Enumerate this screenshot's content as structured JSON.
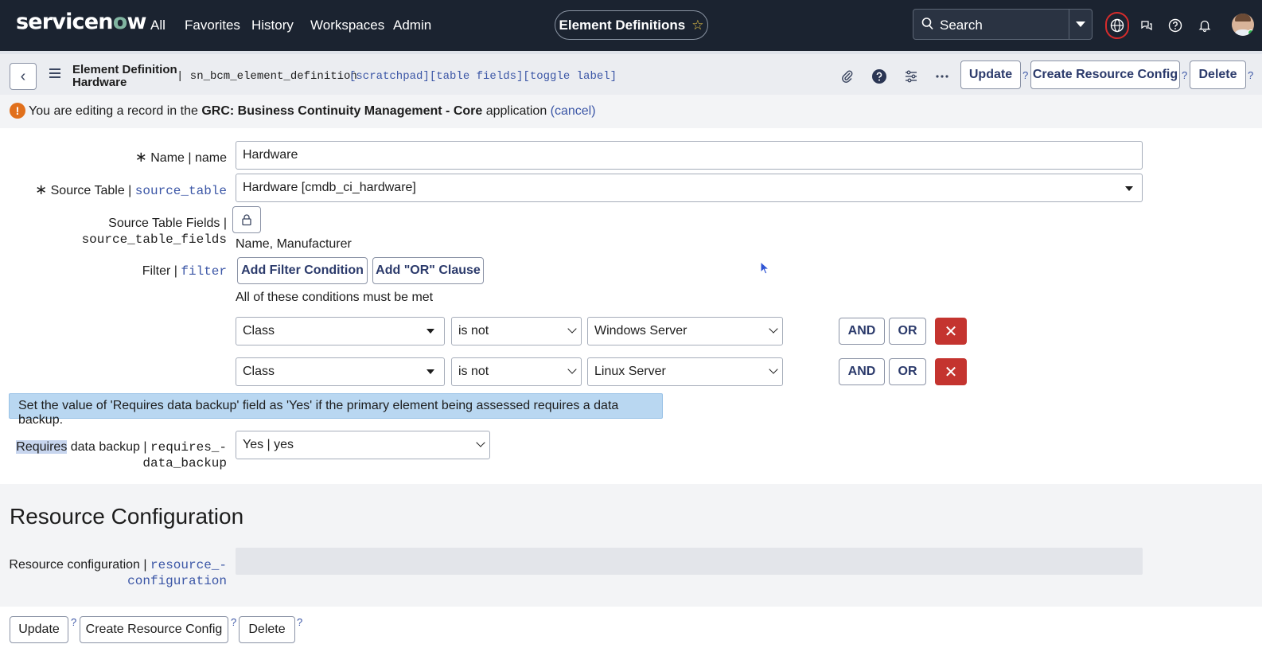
{
  "topnav": {
    "logo_pre": "servicen",
    "logo_o": "o",
    "logo_post": "w",
    "items": [
      "All",
      "Favorites",
      "History",
      "Workspaces",
      "Admin"
    ],
    "context_title": "Element Definitions",
    "search_placeholder": "Search"
  },
  "header": {
    "record_type": "Element Definition",
    "record_name": "Hardware",
    "table_name": "| sn_bcm_element_definition",
    "links": "[scratchpad][table fields][toggle label]",
    "buttons": {
      "update": "Update",
      "create": "Create Resource Config",
      "delete": "Delete"
    },
    "help": "?"
  },
  "banner": {
    "prefix": "You are editing a record in the ",
    "app": "GRC: Business Continuity Management - Core",
    "suffix": " application ",
    "cancel": "(cancel)"
  },
  "form": {
    "name": {
      "label": "Name | name",
      "value": "Hardware"
    },
    "source_table": {
      "label": "Source Table | ",
      "field": "source_table",
      "value": "Hardware [cmdb_ci_hardware]"
    },
    "source_table_fields": {
      "label": "Source Table Fields |",
      "field": "source_table_fields",
      "value": "Name, Manufacturer"
    },
    "filter": {
      "label": "Filter | ",
      "field": "filter",
      "add_condition": "Add Filter Condition",
      "add_or": "Add \"OR\" Clause",
      "note": "All of these conditions must be met",
      "conditions": [
        {
          "field": "Class",
          "operator": "is not",
          "value": "Windows Server"
        },
        {
          "field": "Class",
          "operator": "is not",
          "value": "Linux Server"
        }
      ],
      "and": "AND",
      "or": "OR"
    },
    "info": "Set the value of 'Requires data backup' field as 'Yes' if the primary element being assessed requires a data backup.",
    "requires_backup": {
      "label_highlight": "Requires",
      "label_rest": " data backup | ",
      "field_line1": "requires_-",
      "field_line2": "data_backup",
      "value": "Yes | yes"
    }
  },
  "resource_section": {
    "title": "Resource Configuration",
    "label": "Resource configuration | ",
    "field_line1": "resource_-",
    "field_line2": "configuration"
  },
  "footer": {
    "update": "Update",
    "create": "Create Resource Config",
    "delete": "Delete",
    "help": "?"
  },
  "colors": {
    "nav_bg": "#1b2330",
    "link": "#3b56a6",
    "danger": "#c4342f",
    "info_bg": "#b9d7f1",
    "warn": "#e1701c"
  }
}
